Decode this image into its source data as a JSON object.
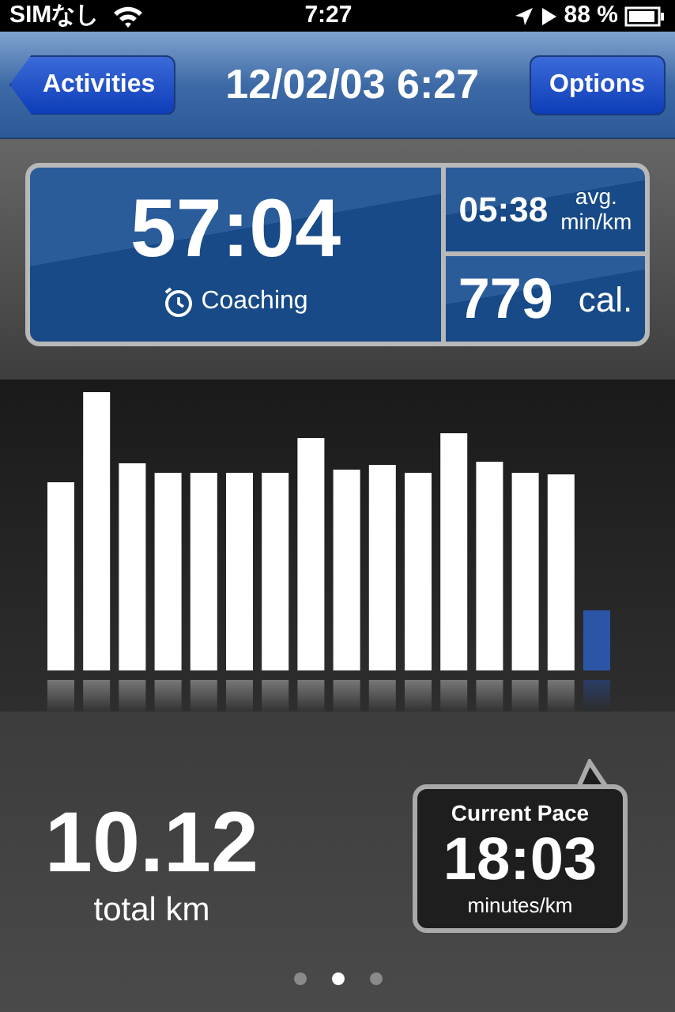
{
  "status_bar": {
    "carrier": "SIMなし",
    "time": "7:27",
    "battery": "88 %"
  },
  "nav_bar": {
    "back_button": "Activities",
    "title": "12/02/03 6:27",
    "right_button": "Options"
  },
  "summary": {
    "duration": "57:04",
    "coaching": "Coaching",
    "pace_value": "05:38",
    "pace_unit_1": "avg.",
    "pace_unit_2": "min/km",
    "calories_value": "779",
    "calories_unit": "cal."
  },
  "distance": {
    "value": "10.12",
    "label": "total km"
  },
  "current_pace": {
    "title": "Current Pace",
    "value": "18:03",
    "unit": "minutes/km"
  },
  "page_dots": [
    {
      "selected": false
    },
    {
      "selected": true
    },
    {
      "selected": false
    }
  ]
}
